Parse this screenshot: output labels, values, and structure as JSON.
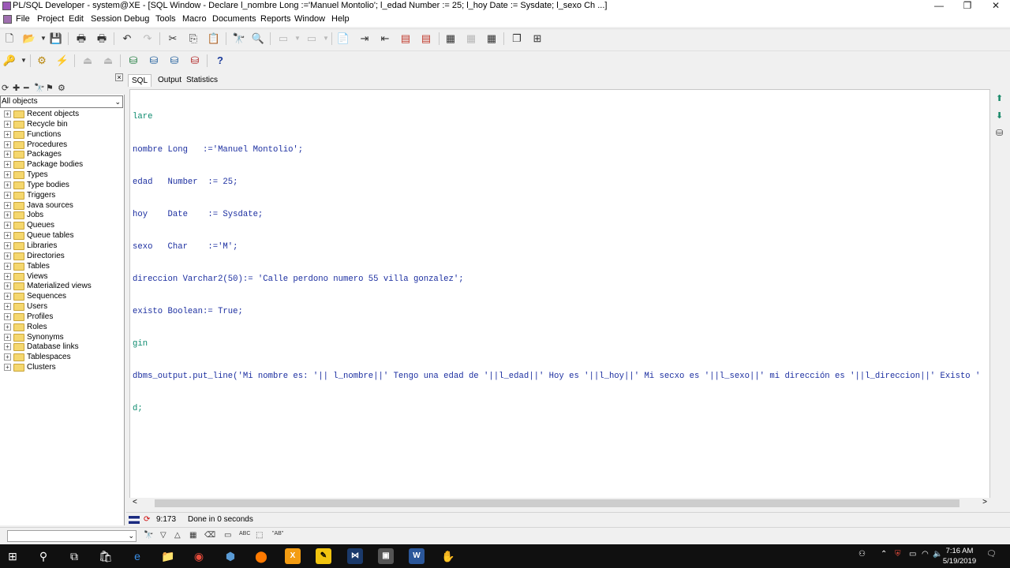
{
  "window": {
    "title": "PL/SQL Developer - system@XE - [SQL Window - Declare l_nombre Long :='Manuel Montolio'; l_edad Number := 25; l_hoy Date := Sysdate; l_sexo Ch ...]",
    "controls": [
      "—",
      "❐",
      "✕"
    ]
  },
  "menu": [
    "File",
    "Project",
    "Edit",
    "Session",
    "Debug",
    "Tools",
    "Macro",
    "Documents",
    "Reports",
    "Window",
    "Help"
  ],
  "browser": {
    "filter": "All objects",
    "items": [
      "Recent objects",
      "Recycle bin",
      "Functions",
      "Procedures",
      "Packages",
      "Package bodies",
      "Types",
      "Type bodies",
      "Triggers",
      "Java sources",
      "Jobs",
      "Queues",
      "Queue tables",
      "Libraries",
      "Directories",
      "Tables",
      "Views",
      "Materialized views",
      "Sequences",
      "Users",
      "Profiles",
      "Roles",
      "Synonyms",
      "Database links",
      "Tablespaces",
      "Clusters"
    ]
  },
  "tabs": [
    "SQL",
    "Output",
    "Statistics"
  ],
  "editor": {
    "lines": [
      "lare",
      "nombre Long   :='Manuel Montolio';",
      "edad   Number  := 25;",
      "hoy    Date    := Sysdate;",
      "sexo   Char    :='M';",
      "direccion Varchar2(50):= 'Calle perdono numero 55 villa gonzalez';",
      "existo Boolean:= True;",
      "gin",
      "dbms_output.put_line('Mi nombre es: '|| l_nombre||' Tengo una edad de '||l_edad||' Hoy es '||l_hoy||' Mi secxo es '||l_sexo||' mi dirección es '||l_direccion||' Existo '",
      "d;"
    ]
  },
  "status": {
    "position": "9:173",
    "message": "Done in 0 seconds"
  },
  "taskbar": {
    "time": "7:16 AM",
    "date": "5/19/2019"
  }
}
